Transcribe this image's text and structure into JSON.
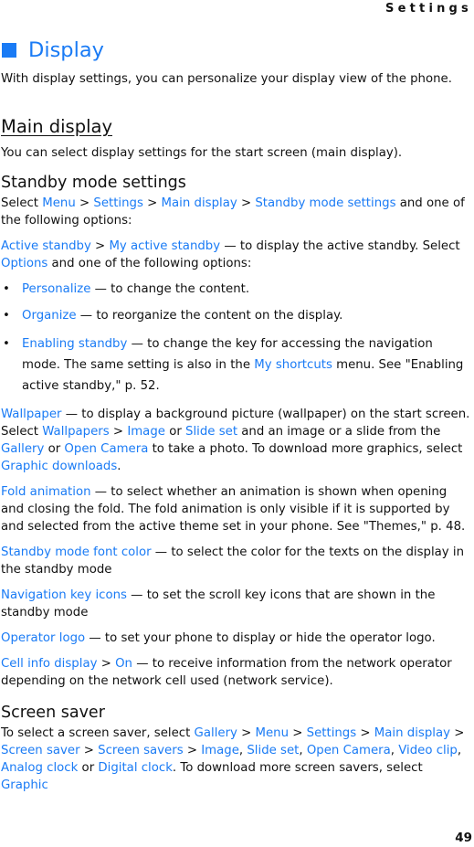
{
  "header": {
    "section": "Settings"
  },
  "footer": {
    "page_number": "49"
  },
  "colors": {
    "accent": "#1a7bf5",
    "text": "#111111"
  },
  "title": "Display",
  "intro": "With display settings, you can personalize your display view of the phone.",
  "main_display": {
    "heading": "Main display",
    "intro": "You can select display settings for the start screen (main display)."
  },
  "standby": {
    "heading": "Standby mode settings",
    "p1": {
      "t0": "Select ",
      "l0": "Menu",
      "t1": " > ",
      "l1": "Settings",
      "t2": " > ",
      "l2": "Main display",
      "t3": " > ",
      "l3": "Standby mode settings",
      "t4": " and one of the following options:"
    },
    "p2": {
      "l0": "Active standby",
      "t0": " > ",
      "l1": "My active standby",
      "t1": " — to display the active standby. Select ",
      "l2": "Options",
      "t2": " and one of the following options:"
    },
    "bullets": [
      {
        "dot": "•",
        "link": "Personalize",
        "text": " — to change the content."
      },
      {
        "dot": "•",
        "link": "Organize",
        "text": " — to reorganize the content on the display."
      },
      {
        "dot": "•",
        "link": "Enabling standby",
        "text": " — to change the key for accessing the navigation mode. The same setting is also in the ",
        "link2": "My shortcuts",
        "text2": " menu. See \"Enabling active standby,\" p. 52."
      }
    ],
    "wallpaper": {
      "l0": "Wallpaper",
      "t0": " — to display a background picture (wallpaper) on the start screen. Select ",
      "l1": "Wallpapers",
      "t1": " > ",
      "l2": "Image",
      "t2": " or ",
      "l3": "Slide set",
      "t3": " and an image or a slide from the ",
      "l4": "Gallery",
      "t4": " or ",
      "l5": "Open Camera",
      "t5": " to take a photo. To download more graphics, select ",
      "l6": "Graphic downloads",
      "t6": "."
    },
    "fold": {
      "l0": "Fold animation",
      "t0": " — to select whether an animation is shown when opening and closing the fold. The fold animation is only visible if it is supported by and selected from the active theme set in your phone. See \"Themes,\" p. 48."
    },
    "fontcolor": {
      "l0": "Standby mode font color",
      "t0": " — to select the color for the texts on the display in the standby mode"
    },
    "navkeys": {
      "l0": "Navigation key icons",
      "t0": " — to set the scroll key icons that are shown in the standby mode"
    },
    "operator": {
      "l0": "Operator logo",
      "t0": " — to set your phone to display or hide the operator logo."
    },
    "cellinfo": {
      "l0": "Cell info display",
      "t0": " > ",
      "l1": "On",
      "t1": " — to receive information from the network operator depending on the network cell used (network service)."
    }
  },
  "screensaver": {
    "heading": "Screen saver",
    "p1": {
      "t0": "To select a screen saver, select ",
      "l0": "Gallery",
      "t1": " > ",
      "l1": "Menu",
      "t2": " > ",
      "l2": "Settings",
      "t3": " > ",
      "l3": "Main display",
      "t4": " > ",
      "l4": "Screen saver",
      "t5": " > ",
      "l5": "Screen savers",
      "t6": " > ",
      "l6": "Image",
      "t7": ", ",
      "l7": "Slide set",
      "t8": ", ",
      "l8": "Open Camera",
      "t9": ", ",
      "l9": "Video clip",
      "t10": ", ",
      "l10": "Analog clock",
      "t11": " or ",
      "l11": "Digital clock",
      "t12": ". To download more screen savers, select ",
      "l12": "Graphic"
    }
  }
}
